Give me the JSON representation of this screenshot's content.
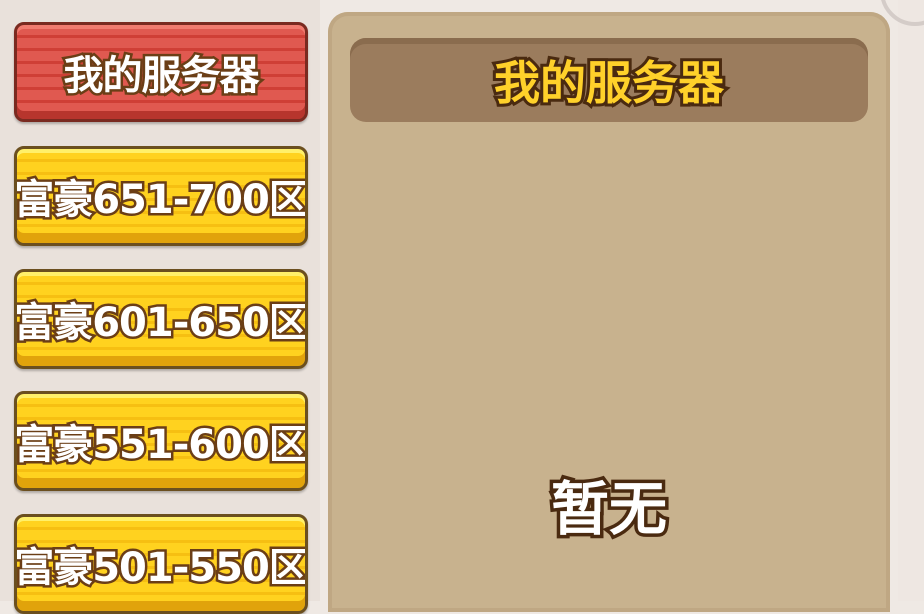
{
  "server_tabs": [
    {
      "label": "我的服务器",
      "state": "selected",
      "color": "#d9473e"
    },
    {
      "label": "富豪651-700区",
      "state": "normal",
      "color": "#ffcf1c"
    },
    {
      "label": "富豪601-650区",
      "state": "normal",
      "color": "#ffcf1c"
    },
    {
      "label": "富豪551-600区",
      "state": "normal",
      "color": "#ffcf1c"
    },
    {
      "label": "富豪501-550区",
      "state": "normal",
      "color": "#ffcf1c"
    }
  ],
  "panel": {
    "title": "我的服务器",
    "empty_message": "暂无"
  },
  "icons": {
    "top_right": "close-button-edge"
  }
}
